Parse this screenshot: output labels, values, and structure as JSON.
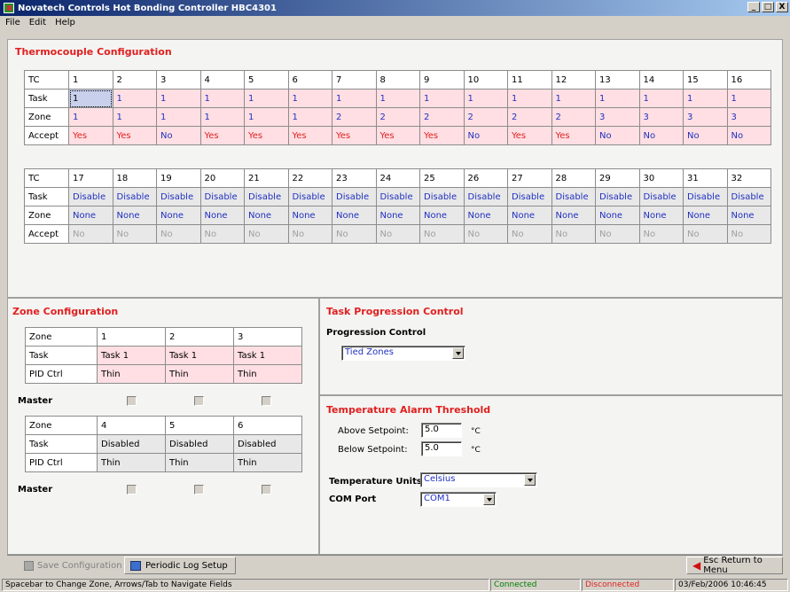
{
  "window": {
    "title": "Novatech Controls Hot Bonding Controller HBC4301",
    "min": "_",
    "max": "□",
    "close": "X"
  },
  "menu": [
    "File",
    "Edit",
    "Help"
  ],
  "thermocouple": {
    "title": "Thermocouple Configuration",
    "row_labels": [
      "TC",
      "Task",
      "Zone",
      "Accept"
    ],
    "table1": {
      "tc": [
        "1",
        "2",
        "3",
        "4",
        "5",
        "6",
        "7",
        "8",
        "9",
        "10",
        "11",
        "12",
        "13",
        "14",
        "15",
        "16"
      ],
      "task": [
        "1",
        "1",
        "1",
        "1",
        "1",
        "1",
        "1",
        "1",
        "1",
        "1",
        "1",
        "1",
        "1",
        "1",
        "1",
        "1"
      ],
      "zone": [
        "1",
        "1",
        "1",
        "1",
        "1",
        "1",
        "2",
        "2",
        "2",
        "2",
        "2",
        "2",
        "3",
        "3",
        "3",
        "3"
      ],
      "accept": [
        "Yes",
        "Yes",
        "No",
        "Yes",
        "Yes",
        "Yes",
        "Yes",
        "Yes",
        "Yes",
        "No",
        "Yes",
        "Yes",
        "No",
        "No",
        "No",
        "No"
      ]
    },
    "table2": {
      "tc": [
        "17",
        "18",
        "19",
        "20",
        "21",
        "22",
        "23",
        "24",
        "25",
        "26",
        "27",
        "28",
        "29",
        "30",
        "31",
        "32"
      ],
      "task": [
        "Disable",
        "Disable",
        "Disable",
        "Disable",
        "Disable",
        "Disable",
        "Disable",
        "Disable",
        "Disable",
        "Disable",
        "Disable",
        "Disable",
        "Disable",
        "Disable",
        "Disable",
        "Disable"
      ],
      "zone": [
        "None",
        "None",
        "None",
        "None",
        "None",
        "None",
        "None",
        "None",
        "None",
        "None",
        "None",
        "None",
        "None",
        "None",
        "None",
        "None"
      ],
      "accept": [
        "No",
        "No",
        "No",
        "No",
        "No",
        "No",
        "No",
        "No",
        "No",
        "No",
        "No",
        "No",
        "No",
        "No",
        "No",
        "No"
      ]
    }
  },
  "zone_config": {
    "title": "Zone Configuration",
    "row_labels": [
      "Zone",
      "Task",
      "PID Ctrl"
    ],
    "master_label": "Master",
    "table1": {
      "zone": [
        "1",
        "2",
        "3"
      ],
      "task": [
        "Task 1",
        "Task 1",
        "Task 1"
      ],
      "pid": [
        "Thin",
        "Thin",
        "Thin"
      ]
    },
    "table2": {
      "zone": [
        "4",
        "5",
        "6"
      ],
      "task": [
        "Disabled",
        "Disabled",
        "Disabled"
      ],
      "pid": [
        "Thin",
        "Thin",
        "Thin"
      ]
    }
  },
  "task_progression": {
    "title": "Task Progression Control",
    "label": "Progression Control",
    "value": "Tied Zones"
  },
  "alarm": {
    "title": "Temperature Alarm Threshold",
    "above_label": "Above Setpoint:",
    "above_value": "5.0",
    "below_label": "Below Setpoint:",
    "below_value": "5.0",
    "unit": "°C",
    "units_label": "Temperature Units",
    "units_value": "Celsius",
    "com_label": "COM Port",
    "com_value": "COM1"
  },
  "buttons": {
    "save": "Save Configuration",
    "log": "Periodic Log Setup",
    "esc": "Esc Return to Menu"
  },
  "status": {
    "hint": "Spacebar to Change Zone, Arrows/Tab to Navigate Fields",
    "connected": "Connected",
    "disconnected": "Disconnected",
    "datetime": "03/Feb/2006  10:46:45"
  },
  "colors": {
    "title_red": "#e02020",
    "value_blue": "#2030c0",
    "pink": "#ffdfe3",
    "gray": "#e8e8e8",
    "connected_green": "#008000"
  }
}
